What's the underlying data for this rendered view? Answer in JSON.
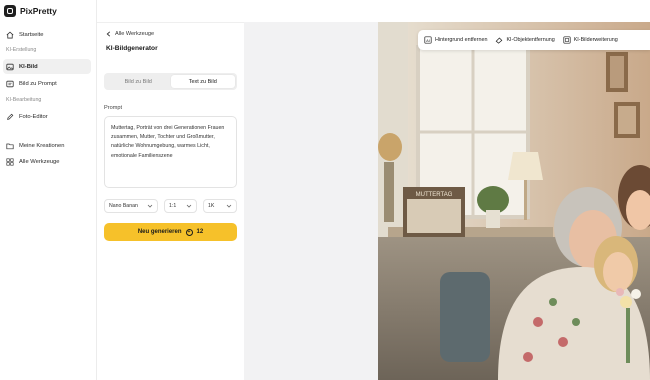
{
  "brand": {
    "name": "PixPretty"
  },
  "sidebar": {
    "home": "Startseite",
    "section_creation": "KI-Erstellung",
    "ki_bild": "KI-Bild",
    "bild_zu_prompt": "Bild zu Prompt",
    "section_editing": "KI-Bearbeitung",
    "foto_editor": "Foto-Editor",
    "meine_kreationen": "Meine Kreationen",
    "alle_werkzeuge": "Alle Werkzeuge"
  },
  "panel": {
    "back_label": "Alle Werkzeuge",
    "title": "KI-Bildgenerator",
    "tabs": [
      {
        "label": "Bild zu Bild",
        "active": false
      },
      {
        "label": "Text zu Bild",
        "active": true
      }
    ],
    "prompt_label": "Prompt",
    "prompt_text": "Muttertag, Porträt von drei Generationen Frauen zusammen, Mutter, Tochter und Großmutter, natürliche Wohnumgebung, warmes Licht, emotionale Familienszene",
    "model_select": "Nano Banan",
    "ratio_select": "1:1",
    "resolution_select": "1K",
    "generate_label": "Neu generieren",
    "credits": "12"
  },
  "toolbar": {
    "remove_bg": "Hintergrund entfernen",
    "object_removal": "KI-Objektentfernung",
    "image_expand": "KI-Bilderweiterung"
  },
  "photo": {
    "frame_caption": "MUTTERTAG"
  },
  "colors": {
    "accent": "#f6c12a",
    "active_nav": "#f0f0f0",
    "canvas_bg": "#f2f2f3"
  }
}
